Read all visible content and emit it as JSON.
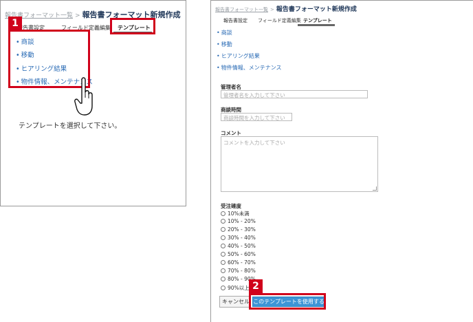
{
  "left": {
    "breadcrumb": {
      "link": "報告書フォーマット一覧",
      "sep": ">",
      "current": "報告書フォーマット新規作成"
    },
    "tabs": [
      "報告書設定",
      "フィールド定義編集",
      "テンプレート"
    ],
    "templates": [
      "商談",
      "移動",
      "ヒアリング結果",
      "物件情報、メンテナンス"
    ],
    "message": "テンプレートを選択して下さい。",
    "badge": "1"
  },
  "right": {
    "breadcrumb": {
      "link": "報告書フォーマット一覧",
      "sep": ">",
      "current": "報告書フォーマット新規作成"
    },
    "tabs": [
      "報告書設定",
      "フィールド定義編集",
      "テンプレート"
    ],
    "templates": [
      "商談",
      "移動",
      "ヒアリング結果",
      "物件情報、メンテナンス"
    ],
    "form": {
      "manager_label": "管理者名",
      "manager_placeholder": "管理者名を入力して下さい",
      "time_label": "商談時間",
      "time_placeholder": "商談時間を入力して下さい",
      "comment_label": "コメント",
      "comment_placeholder": "コメントを入力して下さい",
      "probability_label": "受注確度",
      "options": [
        "10%未満",
        "10% - 20%",
        "20% - 30%",
        "30% - 40%",
        "40% - 50%",
        "50% - 60%",
        "60% - 70%",
        "70% - 80%",
        "80% - 90%",
        "90%以上"
      ]
    },
    "cancel_label": "キャンセル",
    "use_label": "このテンプレートを使用する",
    "badge": "2"
  },
  "colors": {
    "highlight": "#d0021b",
    "link": "#2a6bb5",
    "primary_button": "#3d95d6"
  },
  "icons": {
    "cursor": "hand-pointer-icon"
  }
}
